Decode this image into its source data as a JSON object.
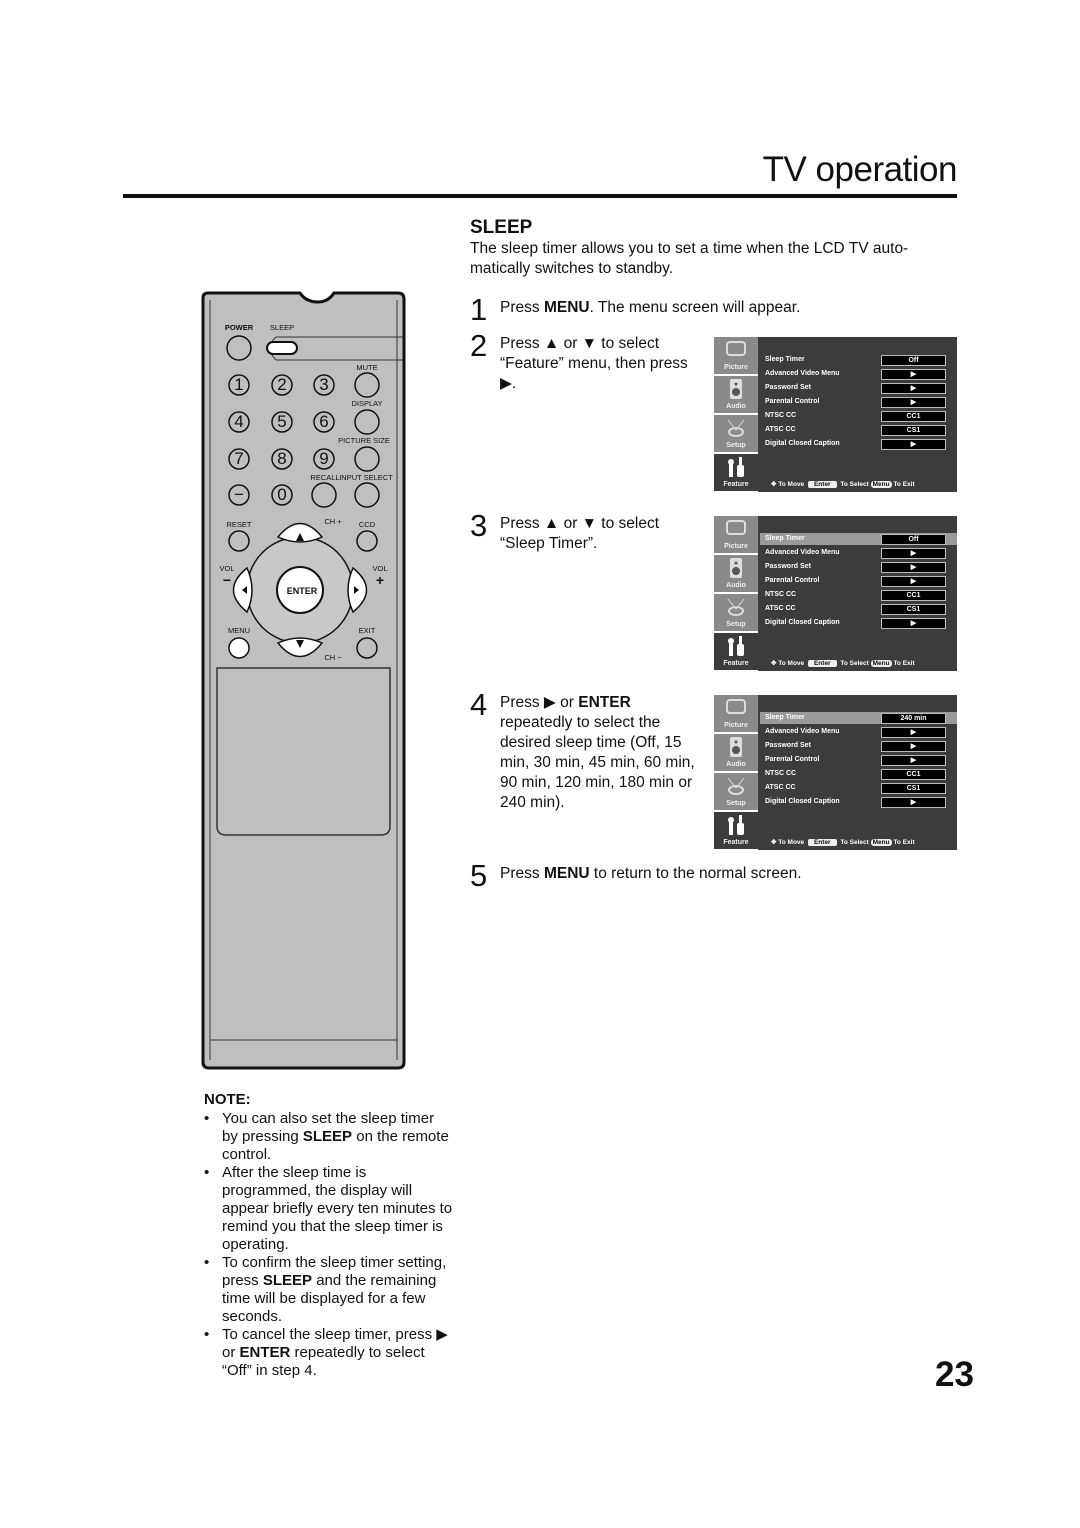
{
  "header": {
    "title": "TV operation"
  },
  "section": {
    "heading": "SLEEP",
    "intro": "The sleep timer allows you to set a time when the LCD TV auto-matically switches to standby."
  },
  "steps": [
    {
      "num": "1",
      "html": "Press <b>MENU</b>. The menu screen will appear."
    },
    {
      "num": "2",
      "html": "Press ▲ or ▼ to select<br>“Feature” menu, then press<br>▶."
    },
    {
      "num": "3",
      "html": "Press ▲ or ▼ to select<br>“Sleep Timer”."
    },
    {
      "num": "4",
      "html": "Press ▶ or <b>ENTER</b><br>repeatedly to select the<br>desired sleep time (Off, 15<br>min, 30 min, 45 min, 60 min,<br>90 min, 120 min, 180 min or<br>240 min)."
    },
    {
      "num": "5",
      "html": "Press <b>MENU</b> to return to the normal screen."
    }
  ],
  "menu": {
    "tabs": [
      "Picture",
      "Audio",
      "Setup",
      "Feature"
    ],
    "items": [
      "Sleep Timer",
      "Advanced Video Menu",
      "Password Set",
      "Parental Control",
      "NTSC CC",
      "ATSC CC",
      "Digital Closed Caption"
    ],
    "values_default": [
      "Off",
      "▶",
      "▶",
      "▶",
      "CC1",
      "CS1",
      "▶"
    ],
    "sleep_selected_value": "240 min",
    "footer": {
      "move": "To Move",
      "enter_key": "Enter",
      "select": "To Select",
      "menu_key": "Menu",
      "exit": "To Exit"
    }
  },
  "remote": {
    "power": "POWER",
    "sleep": "SLEEP",
    "mute": "MUTE",
    "display": "DISPLAY",
    "picture_size": "PICTURE SIZE",
    "recall": "RECALL",
    "input_select": "INPUT SELECT",
    "reset": "RESET",
    "ch_plus": "CH +",
    "ccd": "CCD",
    "vol": "VOL",
    "minus": "−",
    "plus": "+",
    "enter": "ENTER",
    "menu": "MENU",
    "exit": "EXIT",
    "ch_minus": "CH −",
    "digits": [
      "1",
      "2",
      "3",
      "4",
      "5",
      "6",
      "7",
      "8",
      "9",
      "−",
      "0"
    ]
  },
  "note": {
    "heading": "NOTE:",
    "items": [
      "You can also set the sleep timer by pressing <b>SLEEP</b> on the remote control.",
      "After the sleep time is programmed, the display will appear briefly every ten minutes to remind you that the sleep timer is operating.",
      "To confirm the sleep timer setting, press <b>SLEEP</b> and the remaining time will be displayed for a few seconds.",
      "To cancel the sleep timer, press ▶ or <b>ENTER</b> repeatedly to select “Off” in step 4."
    ]
  },
  "page_number": "23"
}
